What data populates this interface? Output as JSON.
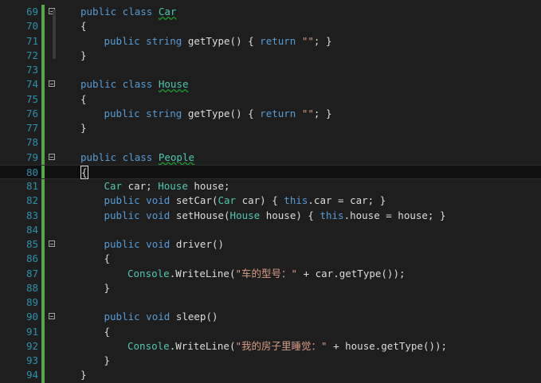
{
  "editor": {
    "lines": [
      {
        "num": "69",
        "fold": "collapse",
        "indent": 0,
        "tokens": [
          {
            "t": "public class ",
            "c": "kw"
          },
          {
            "t": "Car",
            "c": "ty",
            "sq": true
          }
        ]
      },
      {
        "num": "70",
        "indent": 0,
        "tokens": [
          {
            "t": "{",
            "c": ""
          }
        ]
      },
      {
        "num": "71",
        "indent": 1,
        "tokens": [
          {
            "t": "public string ",
            "c": "kw"
          },
          {
            "t": "getType() { ",
            "c": ""
          },
          {
            "t": "return ",
            "c": "kw"
          },
          {
            "t": "\"\"",
            "c": "str"
          },
          {
            "t": "; }",
            "c": ""
          }
        ]
      },
      {
        "num": "72",
        "indent": 0,
        "tokens": [
          {
            "t": "}",
            "c": ""
          }
        ]
      },
      {
        "num": "73",
        "indent": 0,
        "tokens": []
      },
      {
        "num": "74",
        "fold": "collapse",
        "indent": 0,
        "tokens": [
          {
            "t": "public class ",
            "c": "kw"
          },
          {
            "t": "House",
            "c": "ty",
            "sq": true
          }
        ]
      },
      {
        "num": "75",
        "indent": 0,
        "tokens": [
          {
            "t": "{",
            "c": ""
          }
        ]
      },
      {
        "num": "76",
        "indent": 1,
        "tokens": [
          {
            "t": "public string ",
            "c": "kw"
          },
          {
            "t": "getType() { ",
            "c": ""
          },
          {
            "t": "return ",
            "c": "kw"
          },
          {
            "t": "\"\"",
            "c": "str"
          },
          {
            "t": "; }",
            "c": ""
          }
        ]
      },
      {
        "num": "77",
        "indent": 0,
        "tokens": [
          {
            "t": "}",
            "c": ""
          }
        ]
      },
      {
        "num": "78",
        "indent": 0,
        "tokens": []
      },
      {
        "num": "79",
        "fold": "collapse",
        "indent": 0,
        "tokens": [
          {
            "t": "public class ",
            "c": "kw"
          },
          {
            "t": "People",
            "c": "ty",
            "sq": true
          }
        ]
      },
      {
        "num": "80",
        "indent": 0,
        "current": true,
        "tokens": [
          {
            "t": "{",
            "c": "",
            "caret": true
          }
        ]
      },
      {
        "num": "81",
        "indent": 1,
        "tokens": [
          {
            "t": "Car",
            "c": "ty"
          },
          {
            "t": " car; ",
            "c": ""
          },
          {
            "t": "House",
            "c": "ty"
          },
          {
            "t": " house;",
            "c": ""
          }
        ]
      },
      {
        "num": "82",
        "indent": 1,
        "tokens": [
          {
            "t": "public void ",
            "c": "kw"
          },
          {
            "t": "setCar(",
            "c": ""
          },
          {
            "t": "Car",
            "c": "ty"
          },
          {
            "t": " car) { ",
            "c": ""
          },
          {
            "t": "this",
            "c": "kw"
          },
          {
            "t": ".car = car; }",
            "c": ""
          }
        ]
      },
      {
        "num": "83",
        "indent": 1,
        "tokens": [
          {
            "t": "public void ",
            "c": "kw"
          },
          {
            "t": "setHouse(",
            "c": ""
          },
          {
            "t": "House",
            "c": "ty"
          },
          {
            "t": " house) { ",
            "c": ""
          },
          {
            "t": "this",
            "c": "kw"
          },
          {
            "t": ".house = house; }",
            "c": ""
          }
        ]
      },
      {
        "num": "84",
        "indent": 1,
        "tokens": []
      },
      {
        "num": "85",
        "fold": "collapse",
        "indent": 1,
        "tokens": [
          {
            "t": "public void ",
            "c": "kw"
          },
          {
            "t": "driver()",
            "c": ""
          }
        ]
      },
      {
        "num": "86",
        "indent": 1,
        "tokens": [
          {
            "t": "{",
            "c": ""
          }
        ]
      },
      {
        "num": "87",
        "indent": 2,
        "tokens": [
          {
            "t": "Console",
            "c": "ty"
          },
          {
            "t": ".WriteLine(",
            "c": ""
          },
          {
            "t": "\"车的型号：\"",
            "c": "str"
          },
          {
            "t": " + car.getType());",
            "c": ""
          }
        ]
      },
      {
        "num": "88",
        "indent": 1,
        "tokens": [
          {
            "t": "}",
            "c": ""
          }
        ]
      },
      {
        "num": "89",
        "indent": 1,
        "tokens": []
      },
      {
        "num": "90",
        "fold": "collapse",
        "indent": 1,
        "tokens": [
          {
            "t": "public void ",
            "c": "kw"
          },
          {
            "t": "sleep()",
            "c": ""
          }
        ]
      },
      {
        "num": "91",
        "indent": 1,
        "tokens": [
          {
            "t": "{",
            "c": ""
          }
        ]
      },
      {
        "num": "92",
        "indent": 2,
        "tokens": [
          {
            "t": "Console",
            "c": "ty"
          },
          {
            "t": ".WriteLine(",
            "c": ""
          },
          {
            "t": "\"我的房子里睡觉：\"",
            "c": "str"
          },
          {
            "t": " + house.getType());",
            "c": ""
          }
        ]
      },
      {
        "num": "93",
        "indent": 1,
        "tokens": [
          {
            "t": "}",
            "c": ""
          }
        ]
      },
      {
        "num": "94",
        "indent": 0,
        "tokens": [
          {
            "t": "}",
            "c": ""
          }
        ]
      }
    ],
    "colors": {
      "background": "#1e1e1e",
      "keyword": "#569cd6",
      "type": "#4ec9b0",
      "string": "#d69d85",
      "line_number": "#2b91af",
      "change_margin": "#57a64a"
    },
    "icons": {
      "fold": "collapse-box-icon"
    }
  }
}
